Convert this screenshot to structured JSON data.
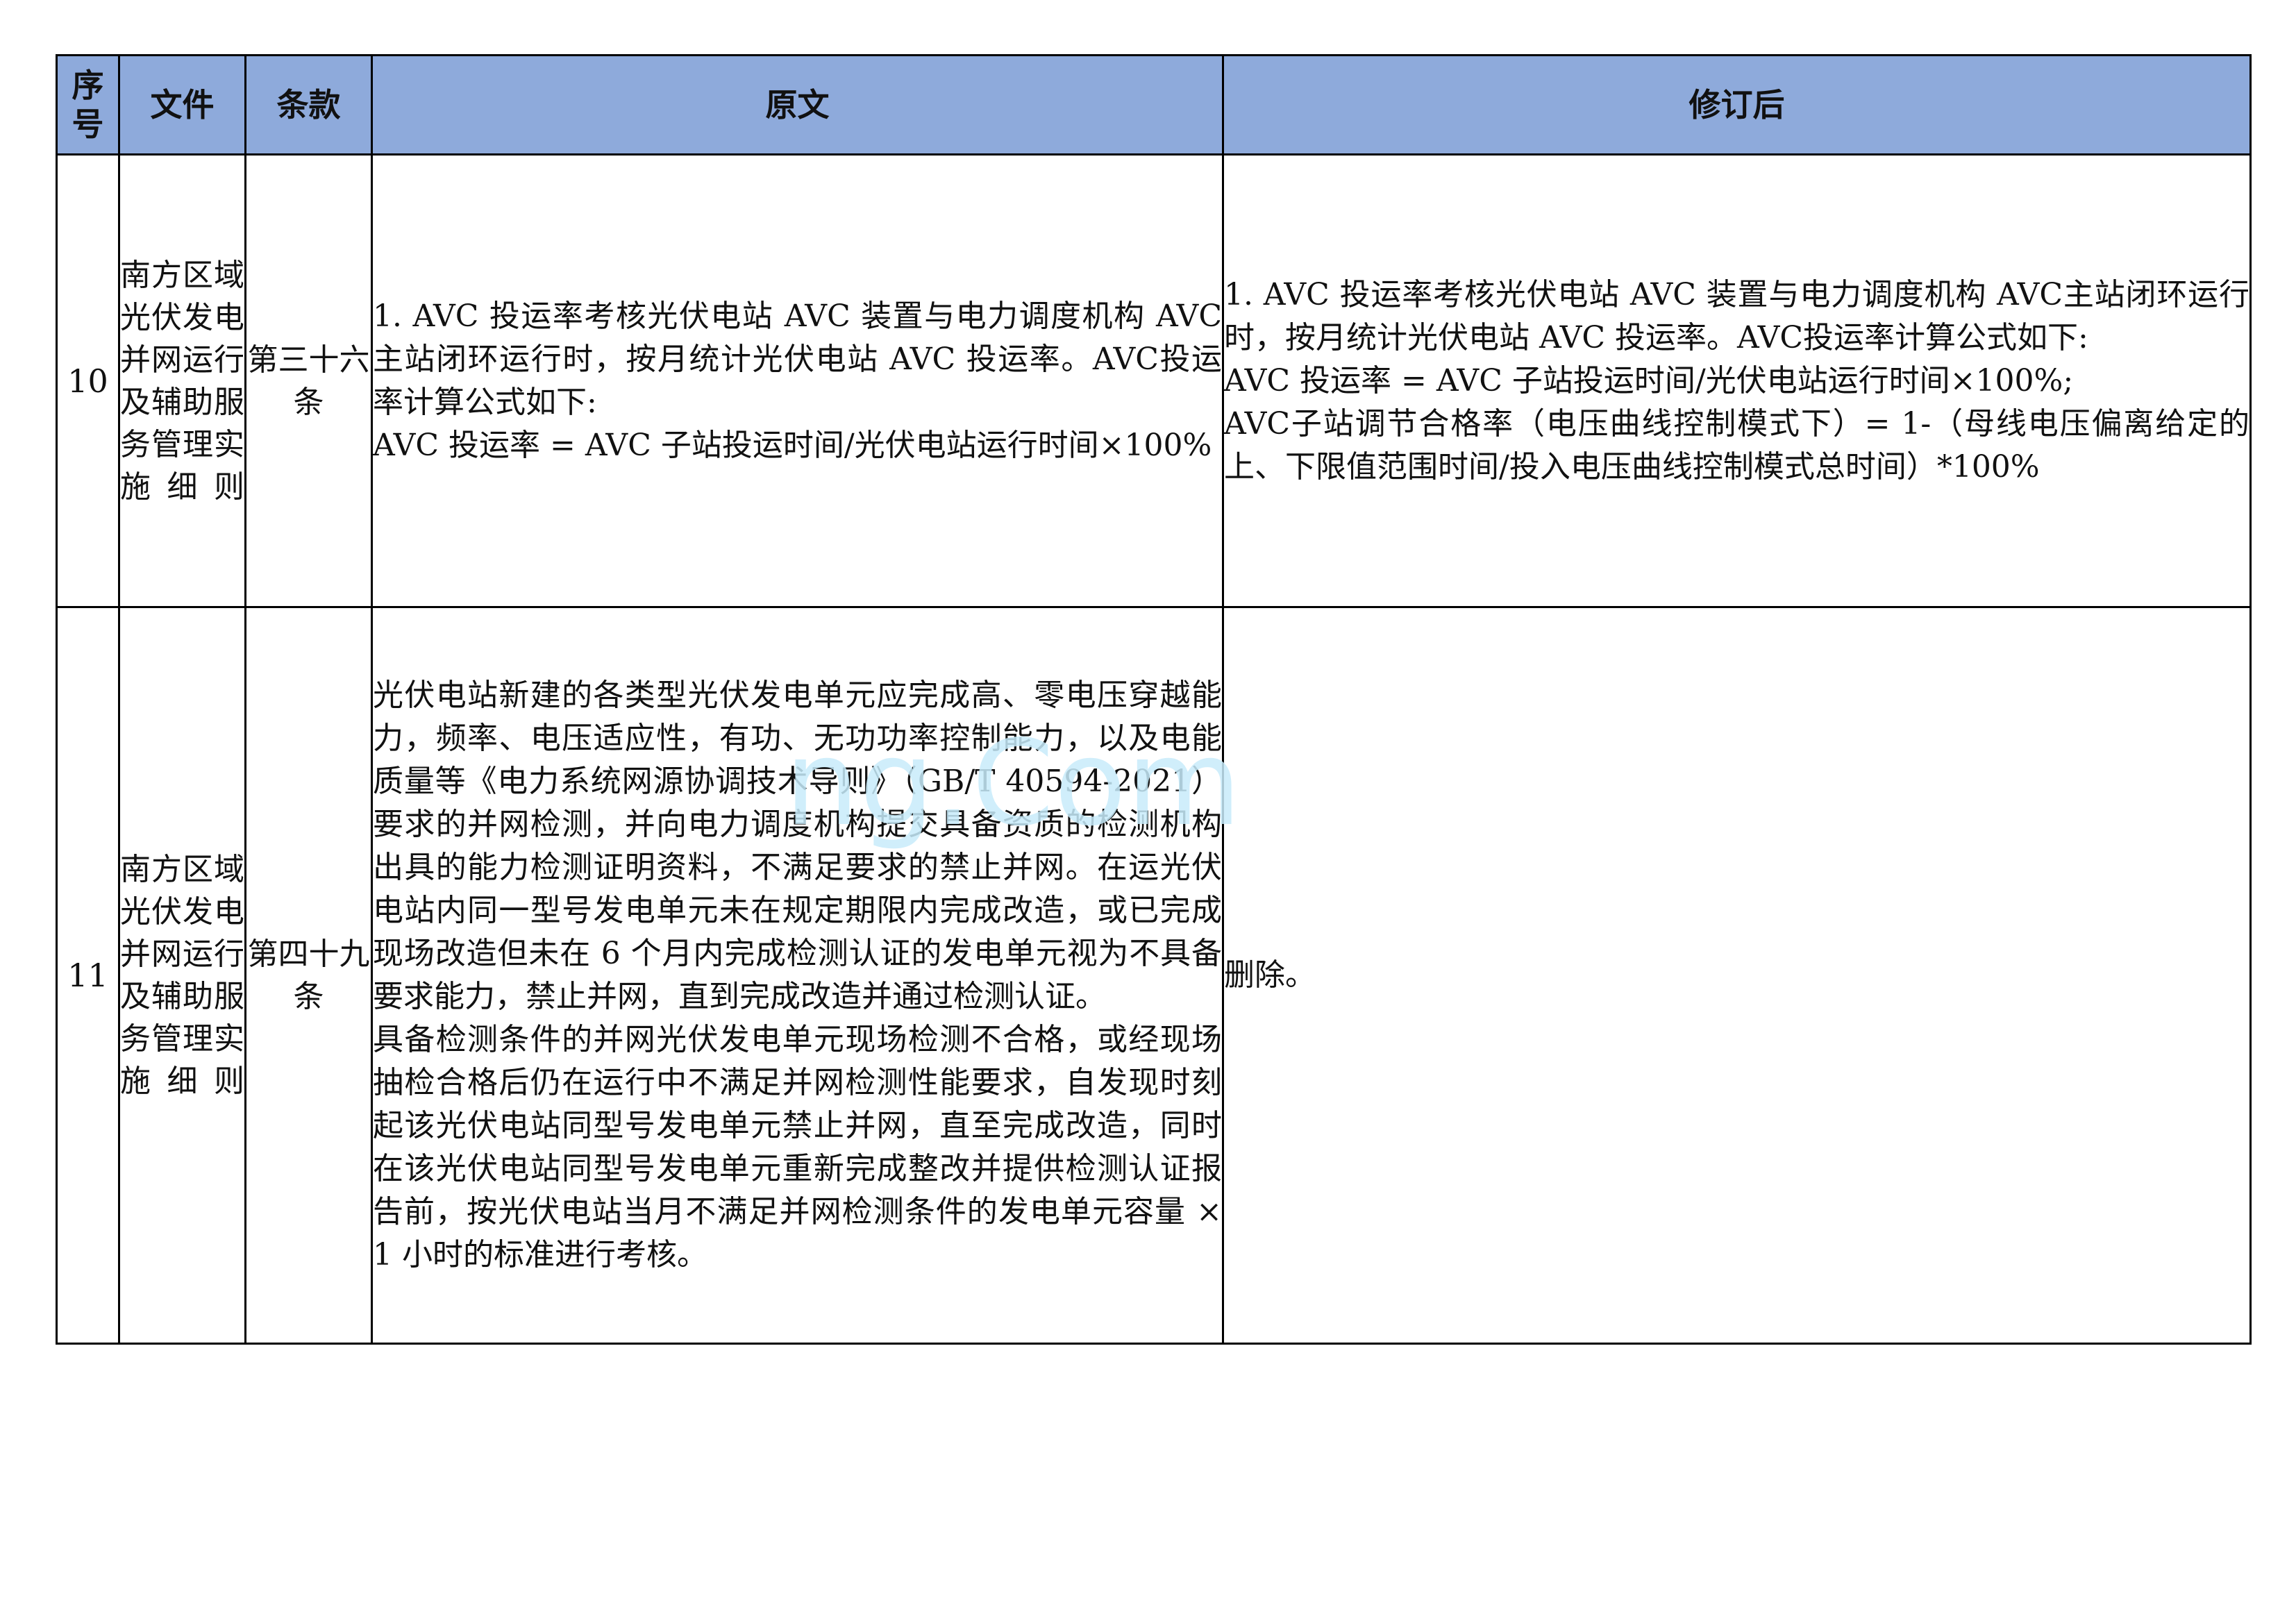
{
  "table": {
    "headers": {
      "no": "序号",
      "file": "文件",
      "clause": "条款",
      "original": "原文",
      "revised": "修订后"
    },
    "rows": [
      {
        "no": "10",
        "file": "南方区域光伏发电并网运行及辅助服务管理实施细则",
        "clause": "第三十六条",
        "original": [
          "1. AVC 投运率考核光伏电站 AVC 装置与电力调度机构 AVC主站闭环运行时，按月统计光伏电站 AVC 投运率。AVC投运率计算公式如下:",
          "AVC 投运率 = AVC 子站投运时间/光伏电站运行时间×100%"
        ],
        "revised": [
          "1. AVC 投运率考核光伏电站 AVC 装置与电力调度机构 AVC主站闭环运行时，按月统计光伏电站 AVC 投运率。AVC投运率计算公式如下:",
          "AVC 投运率 = AVC 子站投运时间/光伏电站运行时间×100%;",
          "AVC子站调节合格率（电压曲线控制模式下）= 1-（母线电压偏离给定的上、下限值范围时间/投入电压曲线控制模式总时间）*100%"
        ]
      },
      {
        "no": "11",
        "file": "南方区域光伏发电并网运行及辅助服务管理实施细则",
        "clause": "第四十九条",
        "original": [
          "光伏电站新建的各类型光伏发电单元应完成高、零电压穿越能力，频率、电压适应性，有功、无功功率控制能力，以及电能质量等《电力系统网源协调技术导则》（GB/T 40594-2021）要求的并网检测，并向电力调度机构提交具备资质的检测机构出具的能力检测证明资料，不满足要求的禁止并网。在运光伏电站内同一型号发电单元未在规定期限内完成改造，或已完成现场改造但未在 6 个月内完成检测认证的发电单元视为不具备要求能力，禁止并网，直到完成改造并通过检测认证。",
          "具备检测条件的并网光伏发电单元现场检测不合格，或经现场抽检合格后仍在运行中不满足并网检测性能要求，自发现时刻起该光伏电站同型号发电单元禁止并网，直至完成改造，同时在该光伏电站同型号发电单元重新完成整改并提供检测认证报告前，按光伏电站当月不满足并网检测条件的发电单元容量 × 1 小时的标准进行考核。"
        ],
        "revised": [
          "删除。"
        ]
      }
    ]
  },
  "watermark": "ng.Com"
}
